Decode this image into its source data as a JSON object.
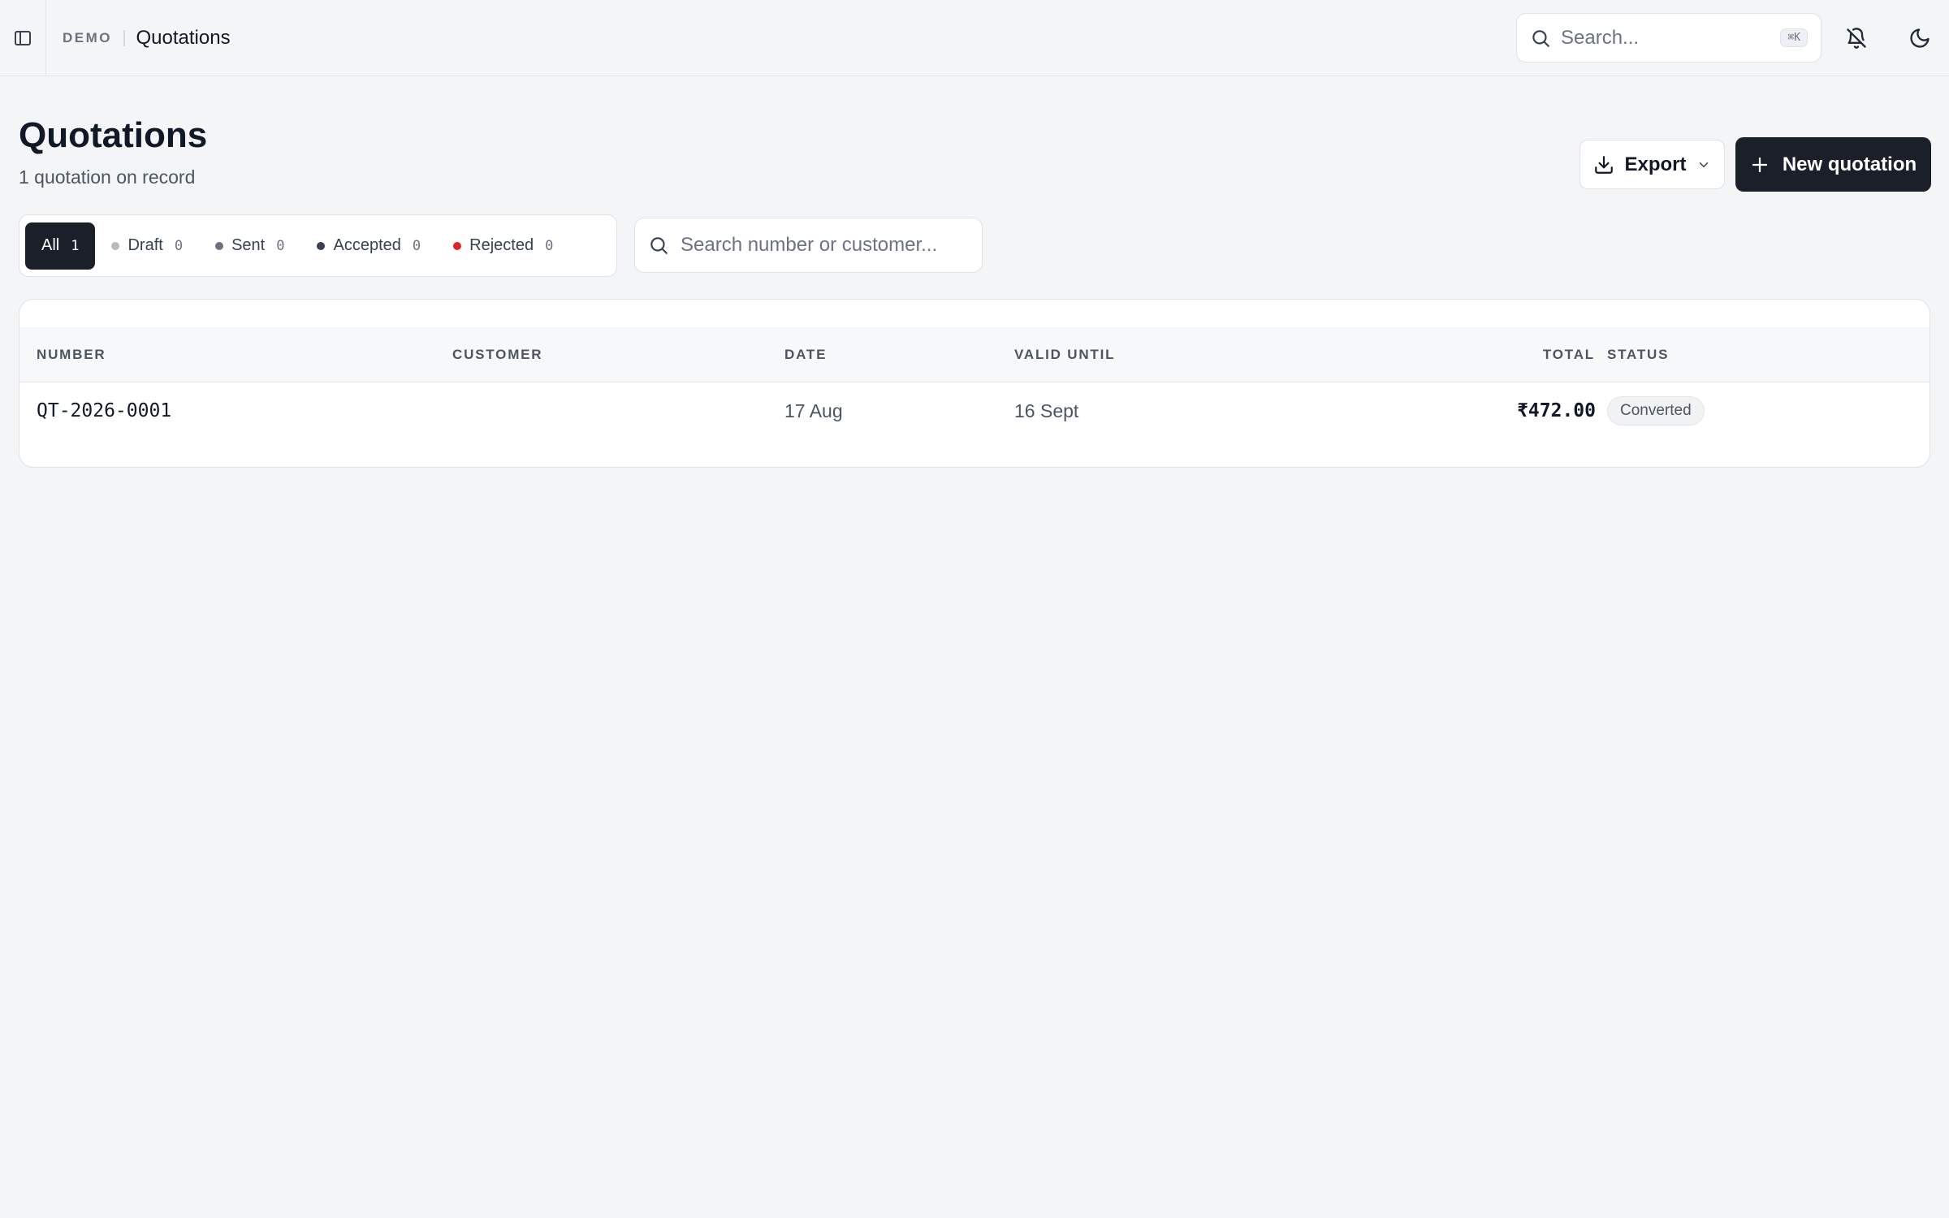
{
  "header": {
    "org": "DEMO",
    "page": "Quotations",
    "search_placeholder": "Search...",
    "search_shortcut": "⌘K",
    "icons": [
      "sidebar-toggle-icon",
      "search-icon",
      "bell-off-icon",
      "moon-icon"
    ]
  },
  "page": {
    "title": "Quotations",
    "subtitle": "1 quotation on record",
    "export_label": "Export",
    "new_label": "New quotation"
  },
  "filters": [
    {
      "label": "All",
      "count": "1",
      "dot_color": ""
    },
    {
      "label": "Draft",
      "count": "0",
      "dot_color": "#b6b9bf"
    },
    {
      "label": "Sent",
      "count": "0",
      "dot_color": "#6b7280"
    },
    {
      "label": "Accepted",
      "count": "0",
      "dot_color": "#374151"
    },
    {
      "label": "Rejected",
      "count": "0",
      "dot_color": "#dc2626"
    }
  ],
  "list_search": {
    "placeholder": "Search number or customer..."
  },
  "table": {
    "columns": [
      "NUMBER",
      "CUSTOMER",
      "DATE",
      "VALID UNTIL",
      "TOTAL",
      "STATUS"
    ],
    "rows": [
      {
        "number": "QT-2026-0001",
        "customer": "",
        "date": "17 Aug",
        "valid_until": "16 Sept",
        "total": "₹472.00",
        "status": "Converted"
      }
    ]
  },
  "colors": {
    "primary": "#1a1f29",
    "background": "#f4f5f7",
    "rejected": "#dc2626"
  }
}
